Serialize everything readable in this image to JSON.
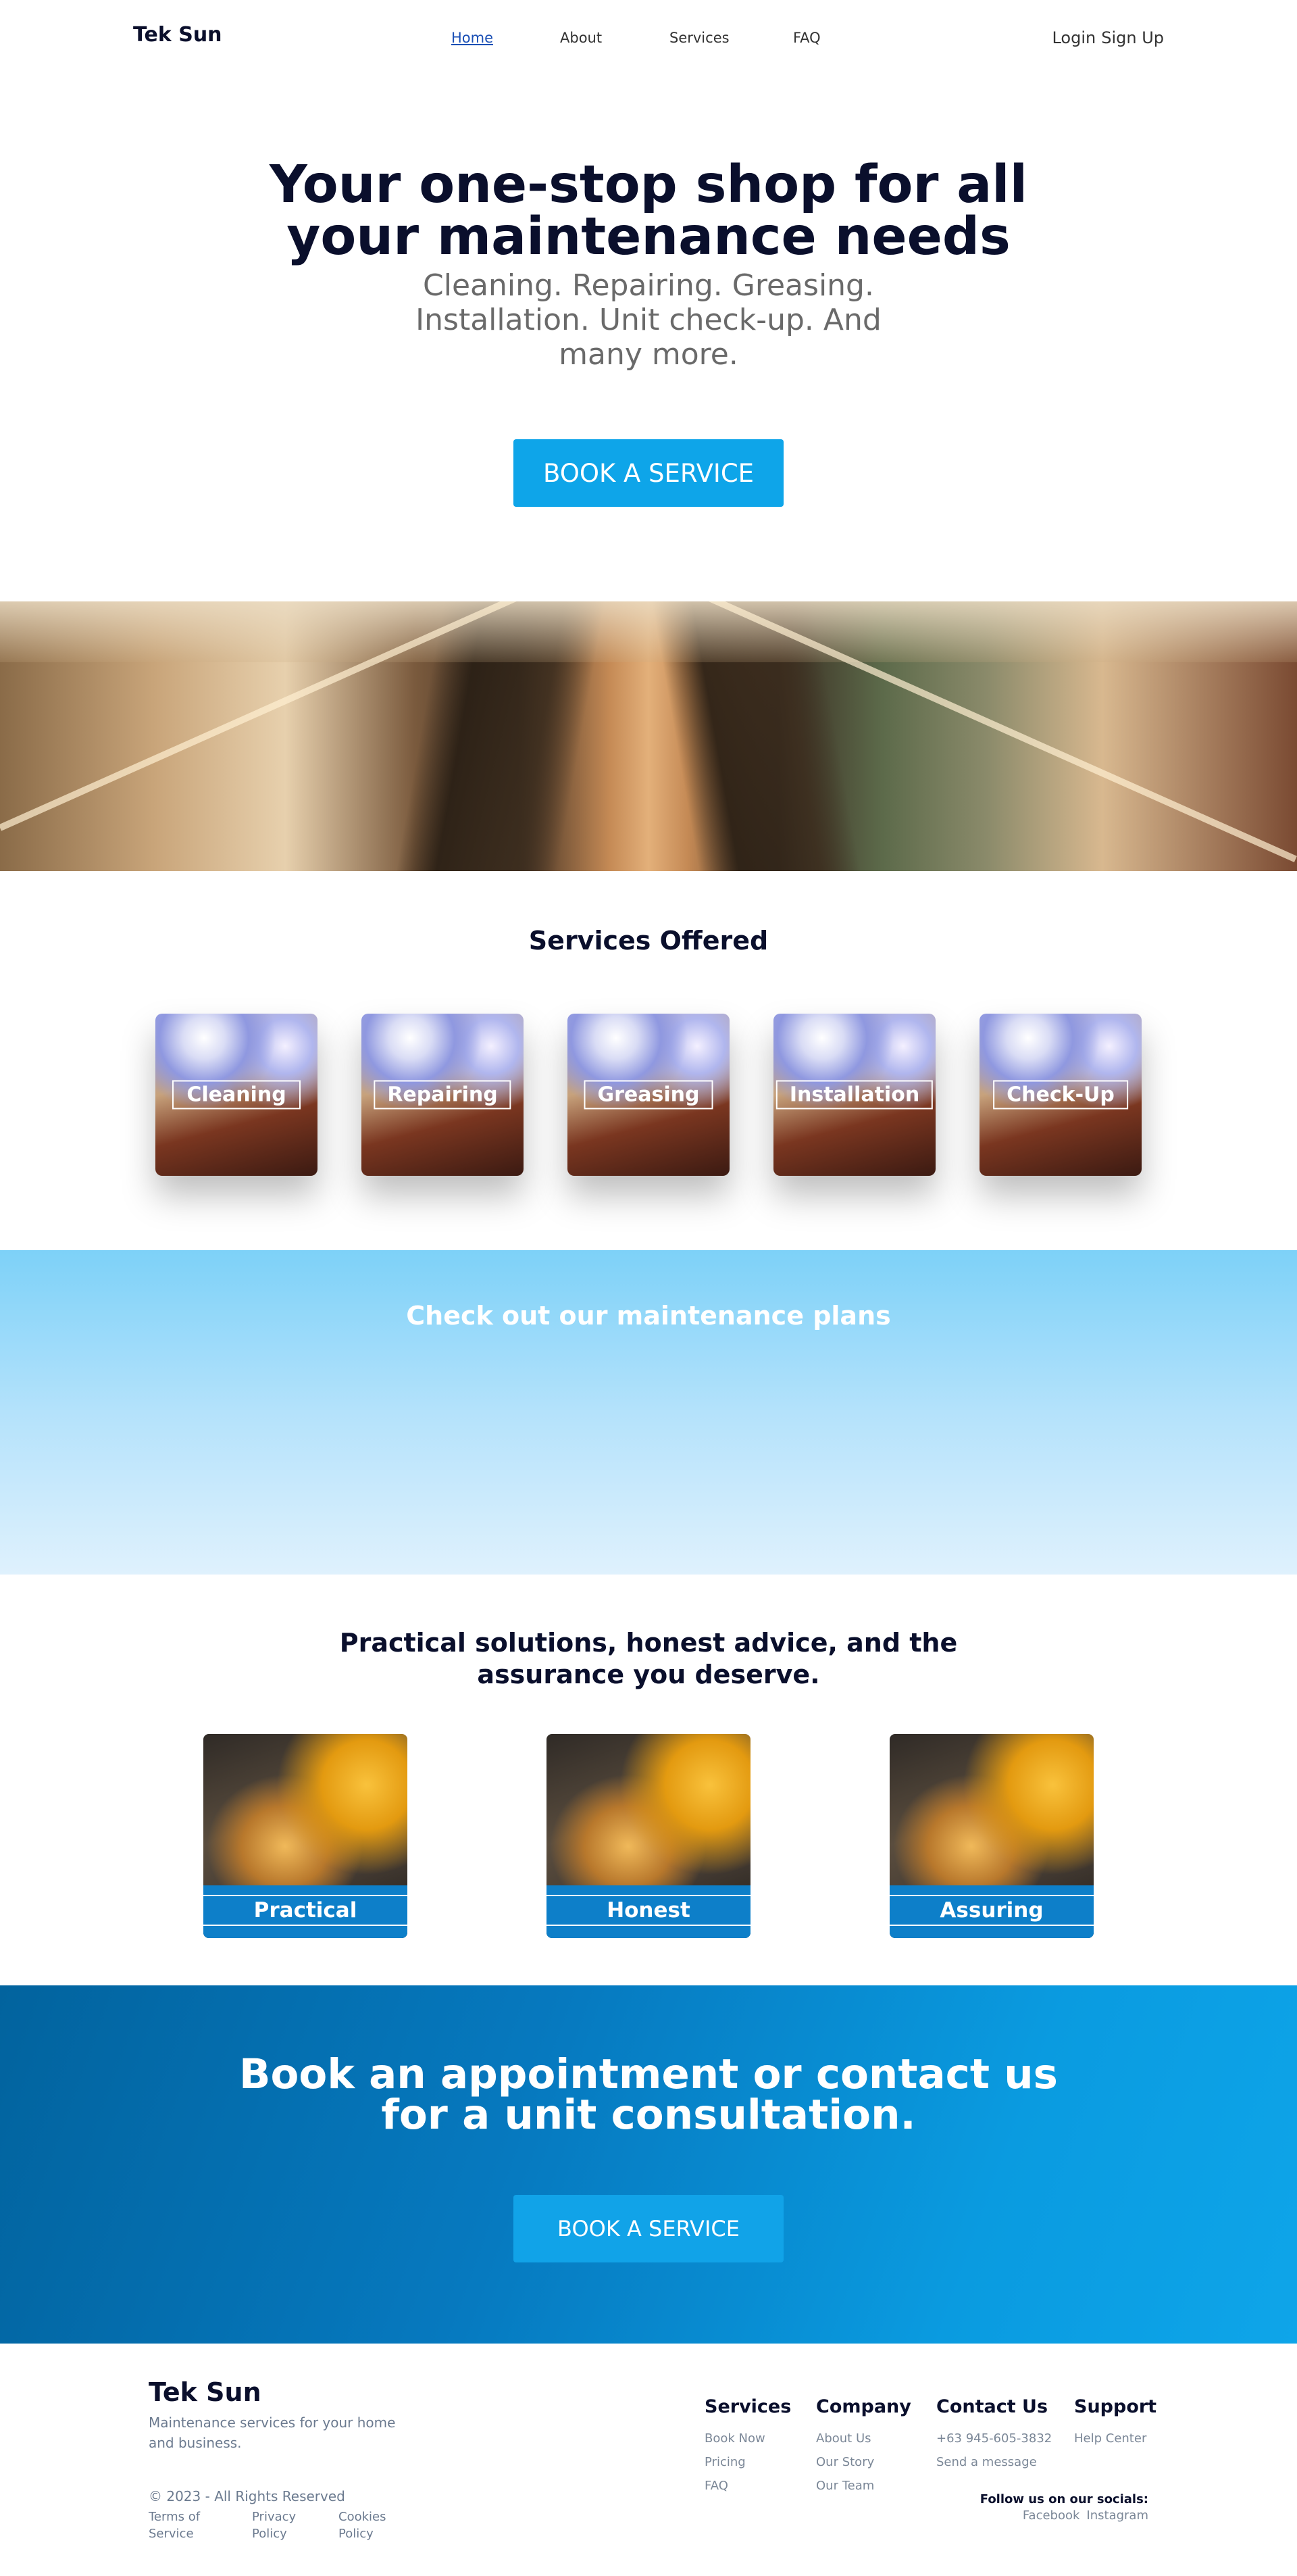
{
  "nav": {
    "brand": "Tek Sun",
    "links": [
      "Home",
      "About",
      "Services",
      "FAQ"
    ],
    "login": "Login",
    "signup": "Sign Up"
  },
  "hero": {
    "title_line1": "Your one-stop shop for all",
    "title_line2": "your maintenance needs",
    "subtitle": "Cleaning. Repairing. Greasing. Installation. Unit check-up. And many more.",
    "button": "BOOK A SERVICE"
  },
  "services": {
    "title": "Services Offered",
    "items": [
      "Cleaning",
      "Repairing",
      "Greasing",
      "Installation",
      "Check-Up"
    ]
  },
  "plans": {
    "title": "Check out our maintenance plans"
  },
  "values": {
    "title": "Practical solutions, honest advice, and the assurance you deserve.",
    "items": [
      "Practical",
      "Honest",
      "Assuring"
    ]
  },
  "cta": {
    "title_line1": "Book an appointment or contact us",
    "title_line2": "for a unit consultation.",
    "button": "BOOK A SERVICE"
  },
  "footer": {
    "brand": "Tek Sun",
    "description": "Maintenance services for your home and business.",
    "copyright": "© 2023 - All Rights Reserved",
    "legal": [
      "Terms of Service",
      "Privacy Policy",
      "Cookies Policy"
    ],
    "columns": [
      {
        "heading": "Services",
        "items": [
          "Book Now",
          "Pricing",
          "FAQ"
        ]
      },
      {
        "heading": "Company",
        "items": [
          "About Us",
          "Our Story",
          "Our Team"
        ]
      },
      {
        "heading": "Contact Us",
        "items": [
          "+63 945-605-3832",
          "Send a message"
        ]
      },
      {
        "heading": "Support",
        "items": [
          "Help Center"
        ]
      }
    ],
    "follow": "Follow us on our socials:",
    "socials": [
      "Facebook",
      "Instagram"
    ]
  },
  "colors": {
    "accent": "#0ea5e9",
    "dark": "#0a0f2c",
    "cta_dark": "#02639e"
  }
}
